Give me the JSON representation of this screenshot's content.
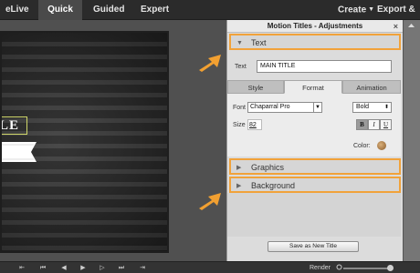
{
  "menubar": {
    "tab_partial": "eLive",
    "tab_quick": "Quick",
    "tab_guided": "Guided",
    "tab_expert": "Expert",
    "create": "Create",
    "export_share": "Export & Sha"
  },
  "preview": {
    "title_text": "LE"
  },
  "panel": {
    "title": "Motion Titles - Adjustments",
    "section_text": "Text",
    "text_label": "Text",
    "text_value": "MAIN TITLE",
    "subtabs": [
      "Style",
      "Format",
      "Animation"
    ],
    "active_subtab": "Format",
    "font_label": "Font",
    "font_value": "Chaparral Pro",
    "weight_value": "Bold",
    "size_label": "Size",
    "size_value": "82",
    "bold_btn": "B",
    "italic_btn": "I",
    "underline_btn": "U",
    "color_label": "Color:",
    "section_graphics": "Graphics",
    "section_background": "Background",
    "save_button": "Save as New Title"
  },
  "transport": {
    "render_label": "Render"
  },
  "colors": {
    "highlight": "#f1a23a",
    "arrow": "#f2a031"
  }
}
